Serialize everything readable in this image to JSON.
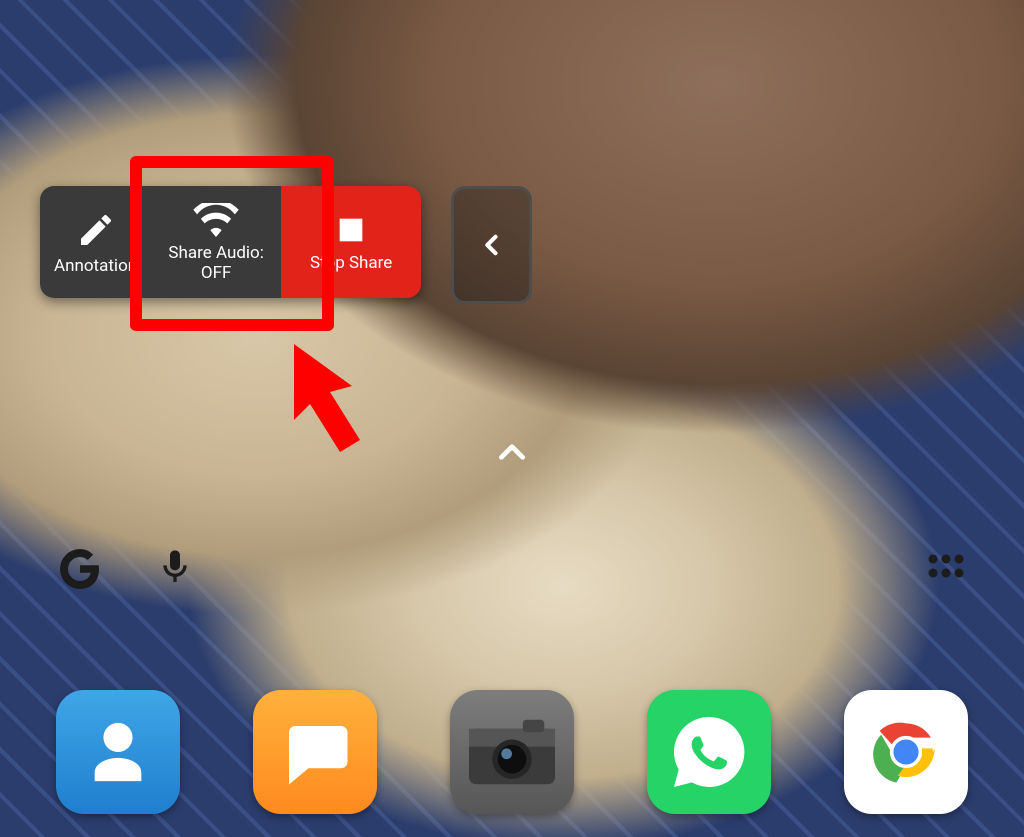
{
  "toolbar": {
    "annotation_label": "Annotation",
    "share_audio_label": "Share Audio:\nOFF",
    "stop_share_label": "Stop Share"
  },
  "home": {
    "drawer_hint": "^"
  },
  "dock": {
    "contacts_name": "Contacts",
    "messages_name": "Messages",
    "camera_name": "Camera",
    "whatsapp_name": "WhatsApp",
    "chrome_name": "Chrome"
  },
  "colors": {
    "highlight": "#ff0000",
    "stop_share": "#e2231a",
    "whatsapp": "#25d366"
  }
}
